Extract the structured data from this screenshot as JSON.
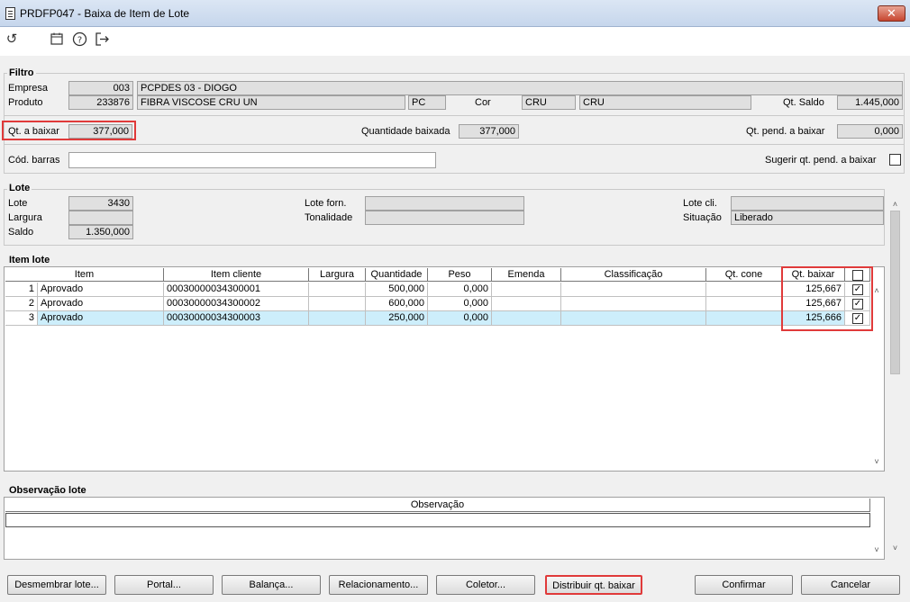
{
  "window": {
    "title": "PRDFP047 - Baixa de Item de Lote",
    "close_label": "✕"
  },
  "toolbar": {
    "undo_icon": "undo-icon",
    "calendar_icon": "calendar-icon",
    "help_icon": "help-icon",
    "exit_icon": "exit-icon"
  },
  "filtro": {
    "legend": "Filtro",
    "empresa_label": "Empresa",
    "empresa_code": "003",
    "empresa_name": "PCPDES 03 - DIOGO",
    "produto_label": "Produto",
    "produto_code": "233876",
    "produto_name": "FIBRA VISCOSE CRU UN",
    "produto_unit": "PC",
    "cor_label": "Cor",
    "cor_code": "CRU",
    "cor_name": "CRU",
    "qt_saldo_label": "Qt. Saldo",
    "qt_saldo": "1.445,000",
    "qt_baixar_label": "Qt. a baixar",
    "qt_baixar": "377,000",
    "qtd_baixada_label": "Quantidade baixada",
    "qtd_baixada": "377,000",
    "qt_pend_label": "Qt. pend. a baixar",
    "qt_pend": "0,000",
    "cod_barras_label": "Cód. barras",
    "cod_barras": "",
    "sugerir_label": "Sugerir qt. pend. a baixar"
  },
  "lote": {
    "legend": "Lote",
    "lote_label": "Lote",
    "lote": "3430",
    "largura_label": "Largura",
    "largura": "",
    "saldo_label": "Saldo",
    "saldo": "1.350,000",
    "lote_forn_label": "Lote forn.",
    "lote_forn": "",
    "tonalidade_label": "Tonalidade",
    "tonalidade": "",
    "lote_cli_label": "Lote cli.",
    "lote_cli": "",
    "situacao_label": "Situação",
    "situacao": "Liberado"
  },
  "item_lote": {
    "legend": "Item lote",
    "columns": [
      "Item",
      "Item cliente",
      "Largura",
      "Quantidade",
      "Peso",
      "Emenda",
      "Classificação",
      "Qt. cone",
      "Qt. baixar"
    ],
    "rows": [
      {
        "n": "1",
        "item": "Aprovado",
        "item_cliente": "00030000034300001",
        "largura": "",
        "quantidade": "500,000",
        "peso": "0,000",
        "emenda": "",
        "classificacao": "",
        "qt_cone": "",
        "qt_baixar": "125,667",
        "checked": "✓"
      },
      {
        "n": "2",
        "item": "Aprovado",
        "item_cliente": "00030000034300002",
        "largura": "",
        "quantidade": "600,000",
        "peso": "0,000",
        "emenda": "",
        "classificacao": "",
        "qt_cone": "",
        "qt_baixar": "125,667",
        "checked": "✓"
      },
      {
        "n": "3",
        "item": "Aprovado",
        "item_cliente": "00030000034300003",
        "largura": "",
        "quantidade": "250,000",
        "peso": "0,000",
        "emenda": "",
        "classificacao": "",
        "qt_cone": "",
        "qt_baixar": "125,666",
        "checked": "✓"
      }
    ],
    "selected_row_color": "#cdeefb"
  },
  "observacao": {
    "legend": "Observação lote",
    "column": "Observação"
  },
  "buttons": {
    "desmembrar": "Desmembrar lote...",
    "portal": "Portal...",
    "balanca": "Balança...",
    "relacionamento": "Relacionamento...",
    "coletor": "Coletor...",
    "distribuir": "Distribuir qt. baixar",
    "confirmar": "Confirmar",
    "cancelar": "Cancelar"
  }
}
